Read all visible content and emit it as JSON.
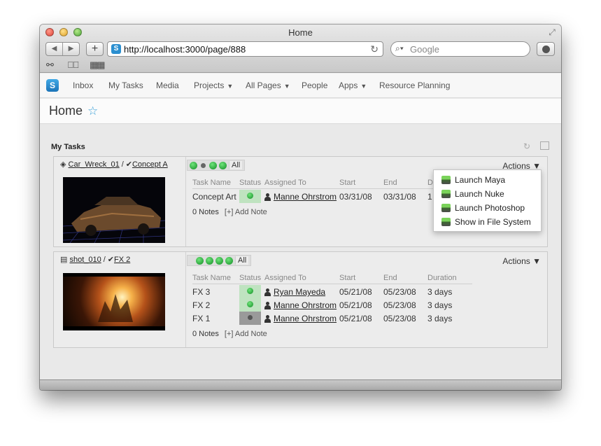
{
  "window": {
    "title": "Home"
  },
  "toolbar": {
    "back_icon": "◀",
    "forward_icon": "▶",
    "add_icon": "+",
    "url": "http://localhost:3000/page/888",
    "search_placeholder": "Google",
    "site_icon_letter": "S"
  },
  "app_nav": {
    "logo_letter": "S",
    "items": [
      "Inbox",
      "My Tasks",
      "Media",
      "Projects",
      "All Pages",
      "People",
      "Apps",
      "Resource Planning"
    ]
  },
  "page": {
    "title": "Home"
  },
  "my_tasks": {
    "title": "My Tasks",
    "columns": [
      "Task Name",
      "Status",
      "Assigned To",
      "Start",
      "End",
      "Duration"
    ],
    "filter_all": "All",
    "actions_label": "Actions",
    "notes_label": "0 Notes",
    "add_note_label": "[+] Add Note",
    "cards": [
      {
        "entity": "Car_Wreck_01",
        "task": "Concept A",
        "rows": [
          {
            "name": "Concept Art",
            "status": "green",
            "assigned": "Manne Ohrstrom",
            "start": "03/31/08",
            "end": "03/31/08",
            "duration": "1"
          }
        ]
      },
      {
        "entity": "shot_010",
        "task": "FX 2",
        "rows": [
          {
            "name": "FX 3",
            "status": "green",
            "assigned": "Ryan Mayeda",
            "start": "05/21/08",
            "end": "05/23/08",
            "duration": "3 days"
          },
          {
            "name": "FX 2",
            "status": "green",
            "assigned": "Manne Ohrstrom",
            "start": "05/21/08",
            "end": "05/23/08",
            "duration": "3 days"
          },
          {
            "name": "FX 1",
            "status": "grey",
            "assigned": "Manne Ohrstrom",
            "start": "05/21/08",
            "end": "05/23/08",
            "duration": "3 days"
          }
        ]
      }
    ]
  },
  "actions_menu": [
    "Launch Maya",
    "Launch Nuke",
    "Launch Photoshop",
    "Show in File System"
  ]
}
